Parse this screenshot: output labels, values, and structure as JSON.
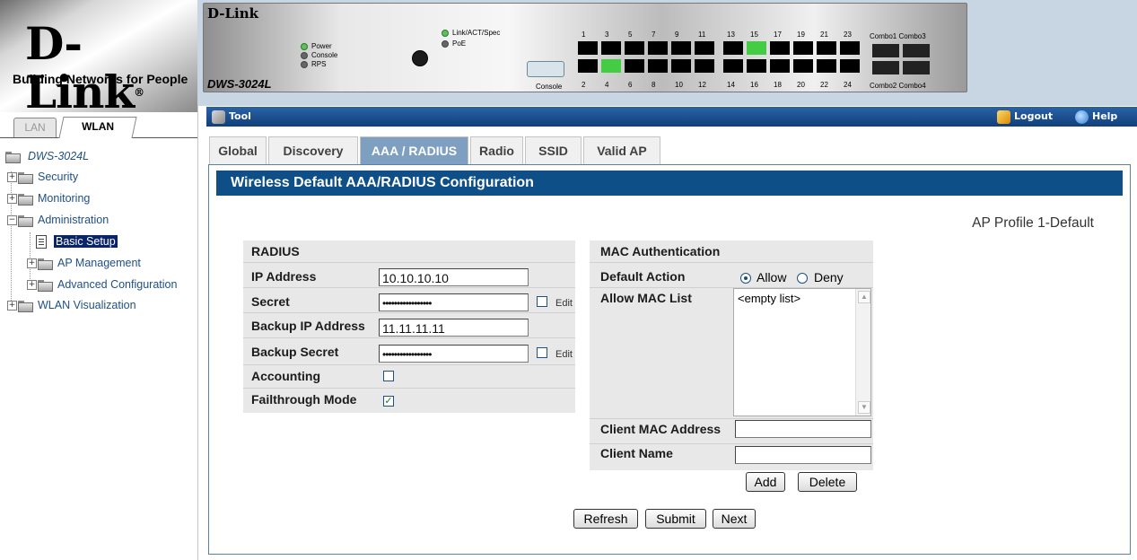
{
  "brand": {
    "logo": "D-Link",
    "tagline": "Building Networks for People"
  },
  "left_tabs": {
    "lan": "LAN",
    "wlan": "WLAN"
  },
  "tree": {
    "root": "DWS-3024L",
    "items": [
      "Security",
      "Monitoring",
      "Administration",
      "Basic Setup",
      "AP Management",
      "Advanced Configuration",
      "WLAN Visualization"
    ]
  },
  "device": {
    "brand": "D-Link",
    "model": "DWS-3024L",
    "led_power": "Power",
    "led_console": "Console",
    "led_rps": "RPS",
    "led_link": "Link/ACT/Spec",
    "led_poe": "PoE",
    "console": "Console",
    "ports_top": [
      "1",
      "3",
      "5",
      "7",
      "9",
      "11",
      "13",
      "15",
      "17",
      "19",
      "21",
      "23"
    ],
    "ports_bottom": [
      "2",
      "4",
      "6",
      "8",
      "10",
      "12",
      "14",
      "16",
      "18",
      "20",
      "22",
      "24"
    ],
    "combo_top": "Combo1 Combo3",
    "combo_bottom": "Combo2 Combo4"
  },
  "toolbar": {
    "tool": "Tool",
    "logout": "Logout",
    "help": "Help"
  },
  "tabs": [
    "Global",
    "Discovery",
    "AAA / RADIUS",
    "Radio",
    "SSID",
    "Valid AP"
  ],
  "panel": {
    "title": "Wireless Default AAA/RADIUS Configuration",
    "profile": "AP Profile 1-Default"
  },
  "radius": {
    "header": "RADIUS",
    "ip_label": "IP Address",
    "ip_value": "10.10.10.10",
    "secret_label": "Secret",
    "secret_value": "•••••••••••••••••",
    "edit_label": "Edit",
    "backup_ip_label": "Backup IP Address",
    "backup_ip_value": "11.11.11.11",
    "backup_secret_label": "Backup Secret",
    "backup_secret_value": "•••••••••••••••••",
    "accounting_label": "Accounting",
    "failthrough_label": "Failthrough Mode"
  },
  "mac": {
    "header": "MAC Authentication",
    "default_action_label": "Default Action",
    "allow": "Allow",
    "deny": "Deny",
    "allow_list_label": "Allow MAC List",
    "allow_list_empty": "<empty list>",
    "client_mac_label": "Client MAC Address",
    "client_name_label": "Client Name",
    "add": "Add",
    "delete": "Delete"
  },
  "buttons": {
    "refresh": "Refresh",
    "submit": "Submit",
    "next": "Next"
  }
}
